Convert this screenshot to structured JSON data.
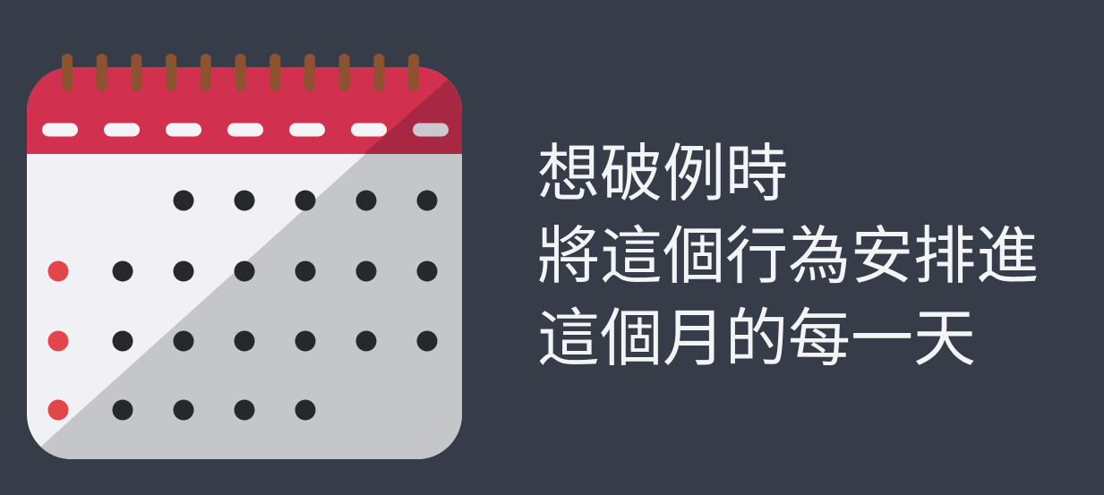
{
  "colors": {
    "background": "#373c49",
    "binding_red": "#d2304f",
    "binding_shade": "#a82742",
    "ring_brown": "#8d5330",
    "page_white": "#f1f1f5",
    "page_shade": "#c5c6c9",
    "dot_dark": "#27282b",
    "dot_red": "#e2454a",
    "text": "#f3f4f6"
  },
  "calendar": {
    "icon": "calendar-icon",
    "rings": 11,
    "tabs": 7,
    "grid": {
      "columns": 7,
      "rows": [
        [
          "",
          "",
          "",
          "dark",
          "dark",
          "dark",
          "dark",
          "dark"
        ],
        [
          "red",
          "dark",
          "dark",
          "dark",
          "dark",
          "dark",
          "dark"
        ],
        [
          "red",
          "dark",
          "dark",
          "dark",
          "dark",
          "dark",
          "dark"
        ],
        [
          "red",
          "dark",
          "dark",
          "dark",
          "dark",
          "",
          ""
        ]
      ]
    }
  },
  "caption": {
    "line1": "想破例時",
    "line2": "將這個行為安排進",
    "line3": "這個月的每一天"
  }
}
